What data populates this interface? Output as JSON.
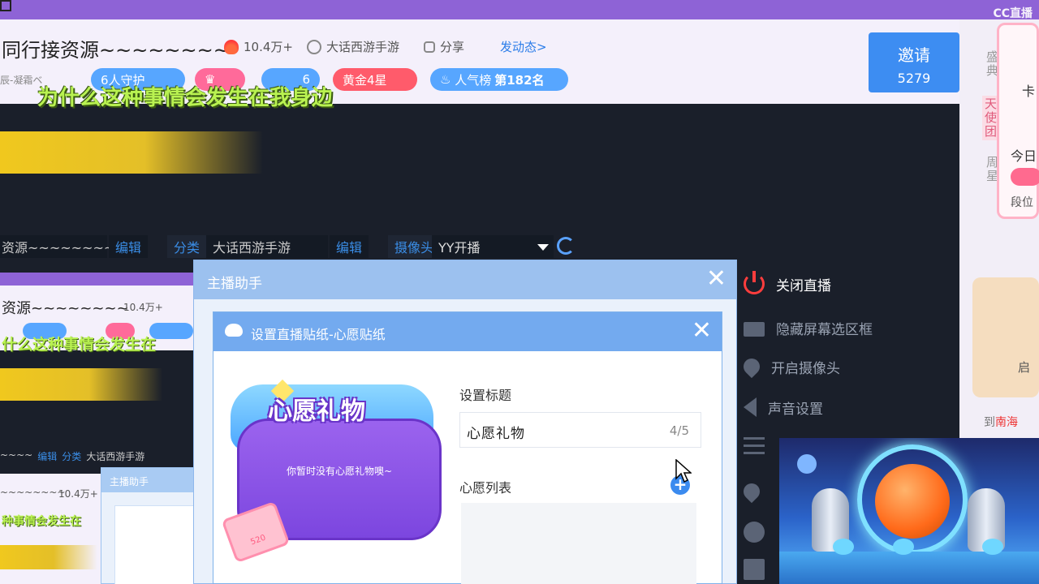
{
  "app": {
    "logo_text": "CC直播"
  },
  "header": {
    "room_title": "同行接资源~~~~~~~~",
    "hot": "10.4万+",
    "game": "大话西游手游",
    "share": "分享",
    "dongtai": "发动态>",
    "sub_left": "辰-凝霜ベ",
    "pills": {
      "guard": "6人守护",
      "fans": "6",
      "gold": "黄金4星",
      "rank_prefix": "人气榜",
      "rank_value": "第182名"
    },
    "overlay_text": "为什么这种事情会发生在我身边"
  },
  "invite": {
    "label": "邀请",
    "count": "5279"
  },
  "right_strip": {
    "t1": "盛典",
    "t2": "天使团",
    "t3": "周星",
    "card_k": "卡",
    "card_today": "今日",
    "card_dw": "段位",
    "img_label": "启",
    "nanhai_prefix": "到",
    "nanhai": "南海"
  },
  "controls": {
    "title_value": "资源~~~~~~~~",
    "edit1": "编辑",
    "category_label": "分类",
    "category_value": "大话西游手游",
    "edit2": "编辑",
    "camera_label": "摄像头",
    "camera_value": "YY开播"
  },
  "mirror": {
    "title": "资源~~~~~~~~",
    "hot": "10.4万+",
    "overlay": "什么这种事情会发生在",
    "row_title": "~~~~",
    "row_edit": "编辑",
    "row_cat": "分类",
    "row_game": "大话西游手游",
    "sub_title": "~~~~~~~~",
    "sub_hot": "10.4万+",
    "sub_overlay": "种事情会发生在",
    "assistant_title": "主播助手"
  },
  "assistant": {
    "title": "主播助手",
    "close": "✕"
  },
  "sticker_dialog": {
    "title": "设置直播贴纸-心愿贴纸",
    "close": "✕",
    "art_title": "心愿礼物",
    "empty_text": "你暂时没有心愿礼物噢~",
    "ticket_text": "520",
    "set_title_label": "设置标题",
    "title_input_value": "心愿礼物",
    "title_count": "4/5",
    "wish_list_label": "心愿列表",
    "add": "+"
  },
  "side_menu": {
    "items": [
      {
        "label": "关闭直播",
        "icon": "power-icon"
      },
      {
        "label": "隐藏屏幕选区框",
        "icon": "monitor-icon"
      },
      {
        "label": "开启摄像头",
        "icon": "location-icon"
      },
      {
        "label": "声音设置",
        "icon": "speaker-icon"
      }
    ]
  },
  "colors": {
    "accent": "#3d8df2",
    "top_bar": "#8e63d6",
    "overlay_green": "#b9f251",
    "danger": "#ff3d3d"
  }
}
